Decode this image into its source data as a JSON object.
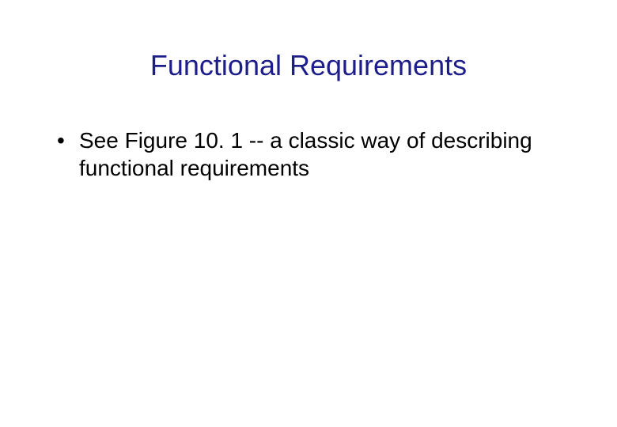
{
  "title": "Functional Requirements",
  "bullets": [
    "See Figure 10. 1 -- a classic way of describing functional requirements"
  ]
}
